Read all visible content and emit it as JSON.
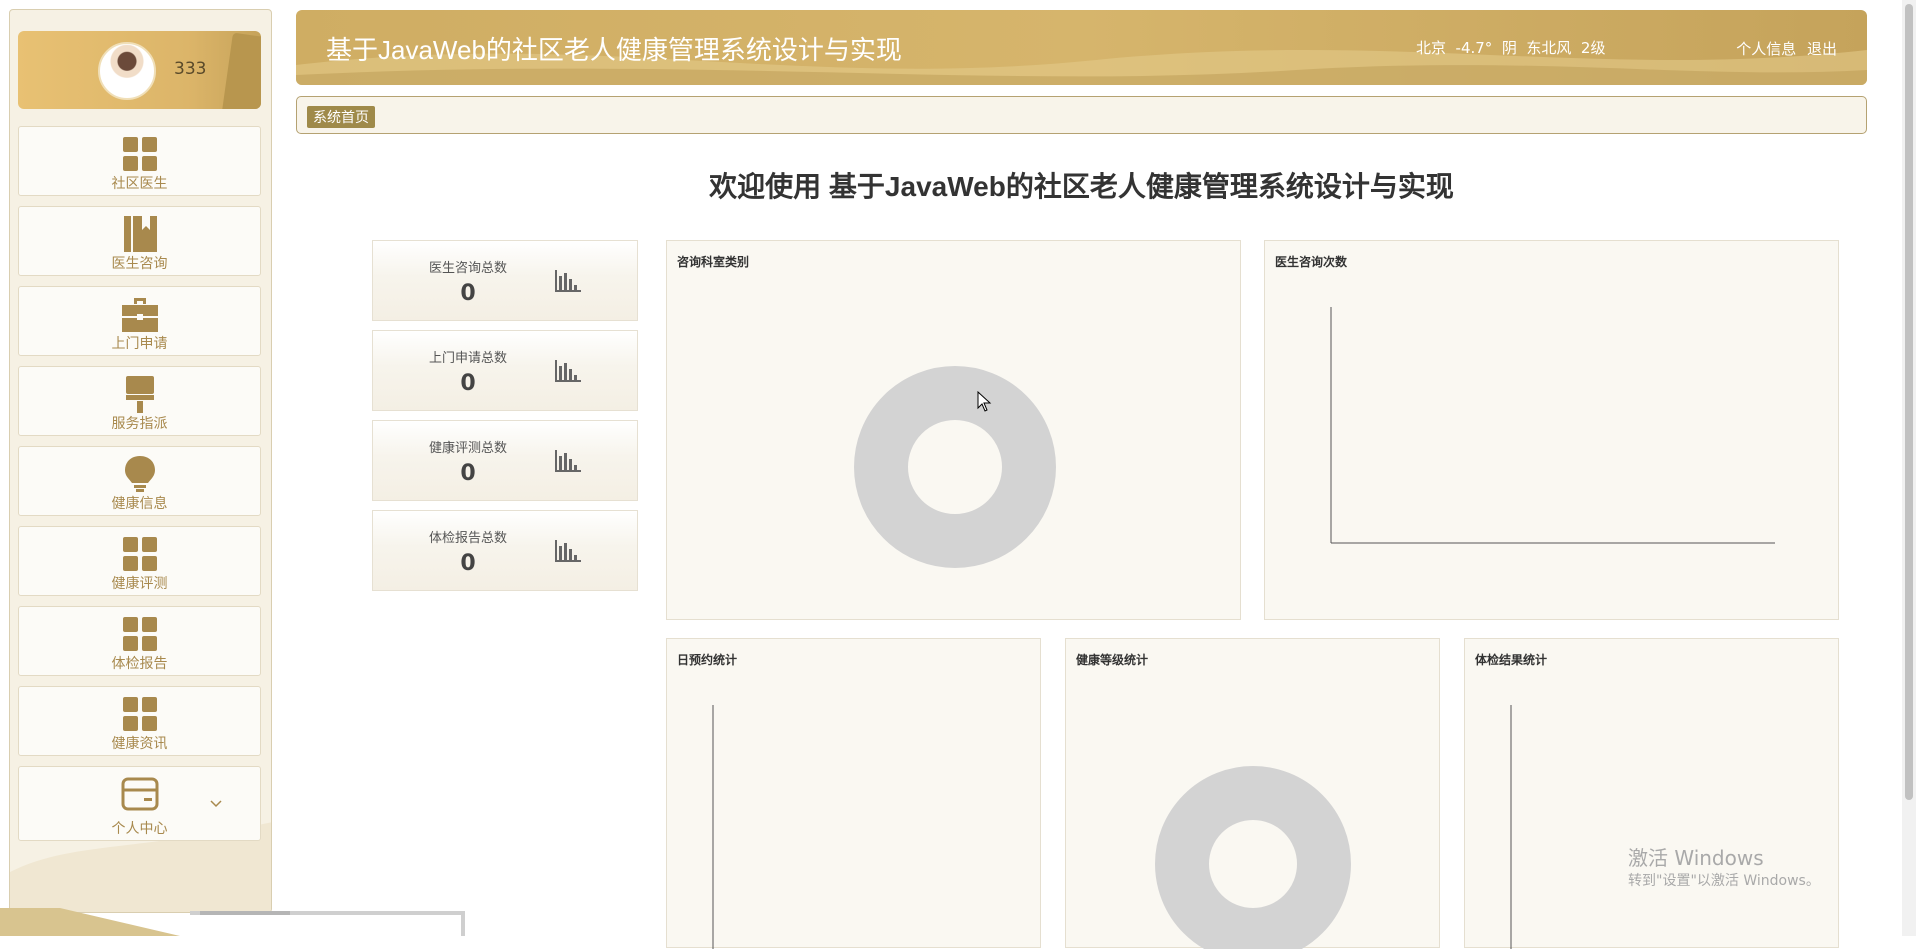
{
  "header": {
    "title": "基于JavaWeb的社区老人健康管理系统设计与实现",
    "weather": "北京  -4.7°  阴  东北风  2级",
    "profile_link": "个人信息",
    "logout_link": "退出"
  },
  "user": {
    "name": "333"
  },
  "sidebar": {
    "items": [
      {
        "label": "社区医生",
        "icon": "grid-icon"
      },
      {
        "label": "医生咨询",
        "icon": "bookmark-icon"
      },
      {
        "label": "上门申请",
        "icon": "briefcase-icon"
      },
      {
        "label": "服务指派",
        "icon": "brush-icon"
      },
      {
        "label": "健康信息",
        "icon": "lightbulb-icon"
      },
      {
        "label": "健康评测",
        "icon": "grid-icon"
      },
      {
        "label": "体检报告",
        "icon": "grid-icon"
      },
      {
        "label": "健康资讯",
        "icon": "grid-icon"
      },
      {
        "label": "个人中心",
        "icon": "card-icon"
      }
    ]
  },
  "breadcrumb": {
    "home": "系统首页"
  },
  "welcome": "欢迎使用 基于JavaWeb的社区老人健康管理系统设计与实现",
  "stats": [
    {
      "label": "医生咨询总数",
      "value": "0"
    },
    {
      "label": "上门申请总数",
      "value": "0"
    },
    {
      "label": "健康评测总数",
      "value": "0"
    },
    {
      "label": "体检报告总数",
      "value": "0"
    }
  ],
  "panels": {
    "consult_dept": "咨询科室类别",
    "consult_count": "医生咨询次数",
    "daily_booking": "日预约统计",
    "health_level": "健康等级统计",
    "checkup_result": "体检结果统计"
  },
  "chart_data": [
    {
      "type": "pie",
      "title": "咨询科室类别",
      "slices": []
    },
    {
      "type": "line",
      "title": "医生咨询次数",
      "x": [],
      "series": []
    },
    {
      "type": "line",
      "title": "日预约统计",
      "x": [],
      "series": []
    },
    {
      "type": "pie",
      "title": "健康等级统计",
      "slices": []
    },
    {
      "type": "line",
      "title": "体检结果统计",
      "x": [],
      "series": []
    }
  ],
  "os_notice": {
    "line1": "激活 Windows",
    "line2": "转到\"设置\"以激活 Windows。"
  },
  "colors": {
    "accent": "#c9a85f",
    "nav_text": "#a8894d",
    "empty_chart": "#d3d3d3"
  }
}
